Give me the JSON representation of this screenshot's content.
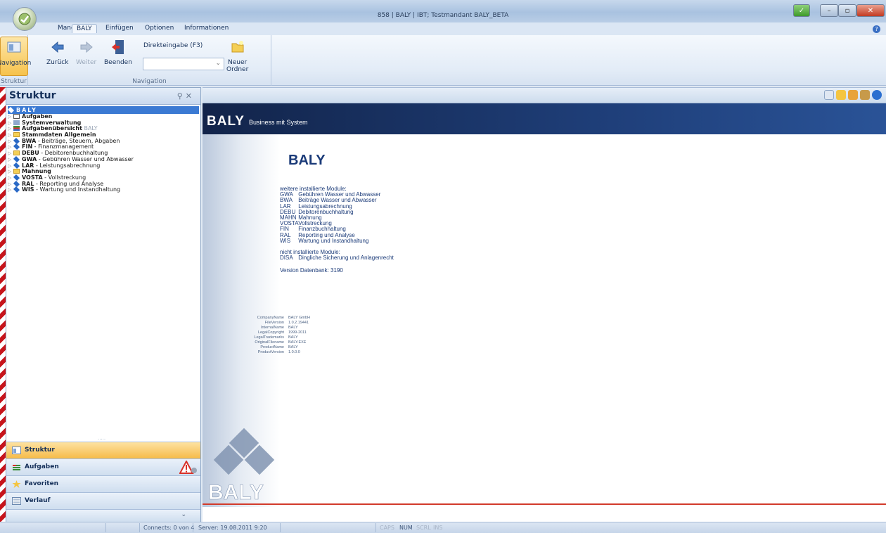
{
  "window": {
    "title": "858 | BALY | IBT; Testmandant BALY_BETA"
  },
  "tabs": [
    "Mandant",
    "BALY",
    "Einfügen",
    "Optionen",
    "Informationen"
  ],
  "ribbon": {
    "navigation_label": "Navigation",
    "struktur_group": "Struktur",
    "zurueck": "Zurück",
    "weiter": "Weiter",
    "beenden": "Beenden",
    "direkt_label": "Direkteingabe (F3)",
    "direkt_value": "",
    "nav_group": "Navigation",
    "neuer_ordner_1": "Neuer",
    "neuer_ordner_2": "Ordner"
  },
  "panel": {
    "title": "Struktur",
    "root": "BALY",
    "tree": [
      {
        "bold": "Aufgaben",
        "rest": "",
        "icon": "task"
      },
      {
        "bold": "Systemverwaltung",
        "rest": "",
        "icon": "system"
      },
      {
        "bold": "Aufgabenübersicht",
        "rest": "BALY",
        "icon": "tasklist"
      },
      {
        "bold": "Stammdaten Allgemein",
        "rest": "",
        "icon": "folder"
      },
      {
        "bold": "BWA",
        "rest": " - Beiträge, Steuern, Abgaben",
        "icon": "diamond"
      },
      {
        "bold": "FIN",
        "rest": " - Finanzmanagement",
        "icon": "diamond"
      },
      {
        "bold": "DEBU",
        "rest": " - Debitorenbuchhaltung",
        "icon": "folder"
      },
      {
        "bold": "GWA",
        "rest": " - Gebühren Wasser und Abwasser",
        "icon": "diamond"
      },
      {
        "bold": "LAR",
        "rest": " - Leistungsabrechnung",
        "icon": "diamond"
      },
      {
        "bold": "Mahnung",
        "rest": "",
        "icon": "folder"
      },
      {
        "bold": "VOSTA",
        "rest": " - Vollstreckung",
        "icon": "diamond"
      },
      {
        "bold": "RAL",
        "rest": " - Reporting und Analyse",
        "icon": "diamond"
      },
      {
        "bold": "WIS",
        "rest": " - Wartung und Instandhaltung",
        "icon": "diamond"
      }
    ],
    "nav_buttons": [
      "Struktur",
      "Aufgaben",
      "Favoriten",
      "Verlauf"
    ]
  },
  "banner": {
    "logo": "BALY",
    "subtitle": "Business mit System"
  },
  "info": {
    "title": "BALY",
    "installed_header": "weitere installierte Module:",
    "installed": [
      {
        "code": "GWA",
        "name": "Gebühren Wasser und Abwasser"
      },
      {
        "code": "BWA",
        "name": "Beiträge Wasser und Abwasser"
      },
      {
        "code": "LAR",
        "name": "Leistungsabrechnung"
      },
      {
        "code": "DEBU",
        "name": "Debitorenbuchhaltung"
      },
      {
        "code": "MAHN",
        "name": "Mahnung"
      },
      {
        "code": "VOSTA",
        "name": "Vollstreckung"
      },
      {
        "code": "FIN",
        "name": "Finanzbuchhaltung"
      },
      {
        "code": "RAL",
        "name": "Reporting und Analyse"
      },
      {
        "code": "WIS",
        "name": "Wartung und Instandhaltung"
      }
    ],
    "not_installed_header": "nicht installierte Module:",
    "not_installed": [
      {
        "code": "DISA",
        "name": "Dingliche Sicherung und Anlagenrecht"
      }
    ],
    "version": "Version Datenbank: 3190"
  },
  "meta": [
    {
      "key": "CompanyName",
      "value": "BALY GmbH"
    },
    {
      "key": "FileVersion",
      "value": "1.0.2.19441"
    },
    {
      "key": "InternalName",
      "value": "BALY"
    },
    {
      "key": "LegalCopyright",
      "value": "1999-2011"
    },
    {
      "key": "LegalTrademarks",
      "value": "BALY"
    },
    {
      "key": "OriginalFilename",
      "value": "BALY.EXE"
    },
    {
      "key": "ProductName",
      "value": "BALY"
    },
    {
      "key": "ProductVersion",
      "value": "1.0.0.0"
    }
  ],
  "status": {
    "connects": "Connects: 0 von 4",
    "server": "Server: 19.08.2011 9:20",
    "caps": "CAPS",
    "num": "NUM",
    "scrl": "SCRL",
    "ins": "INS"
  },
  "colors": {
    "banner": "#1f3f7a",
    "accent_orange": "#f6bb49",
    "stripe_red": "#c7141b",
    "footer_line": "#d23a2a"
  }
}
